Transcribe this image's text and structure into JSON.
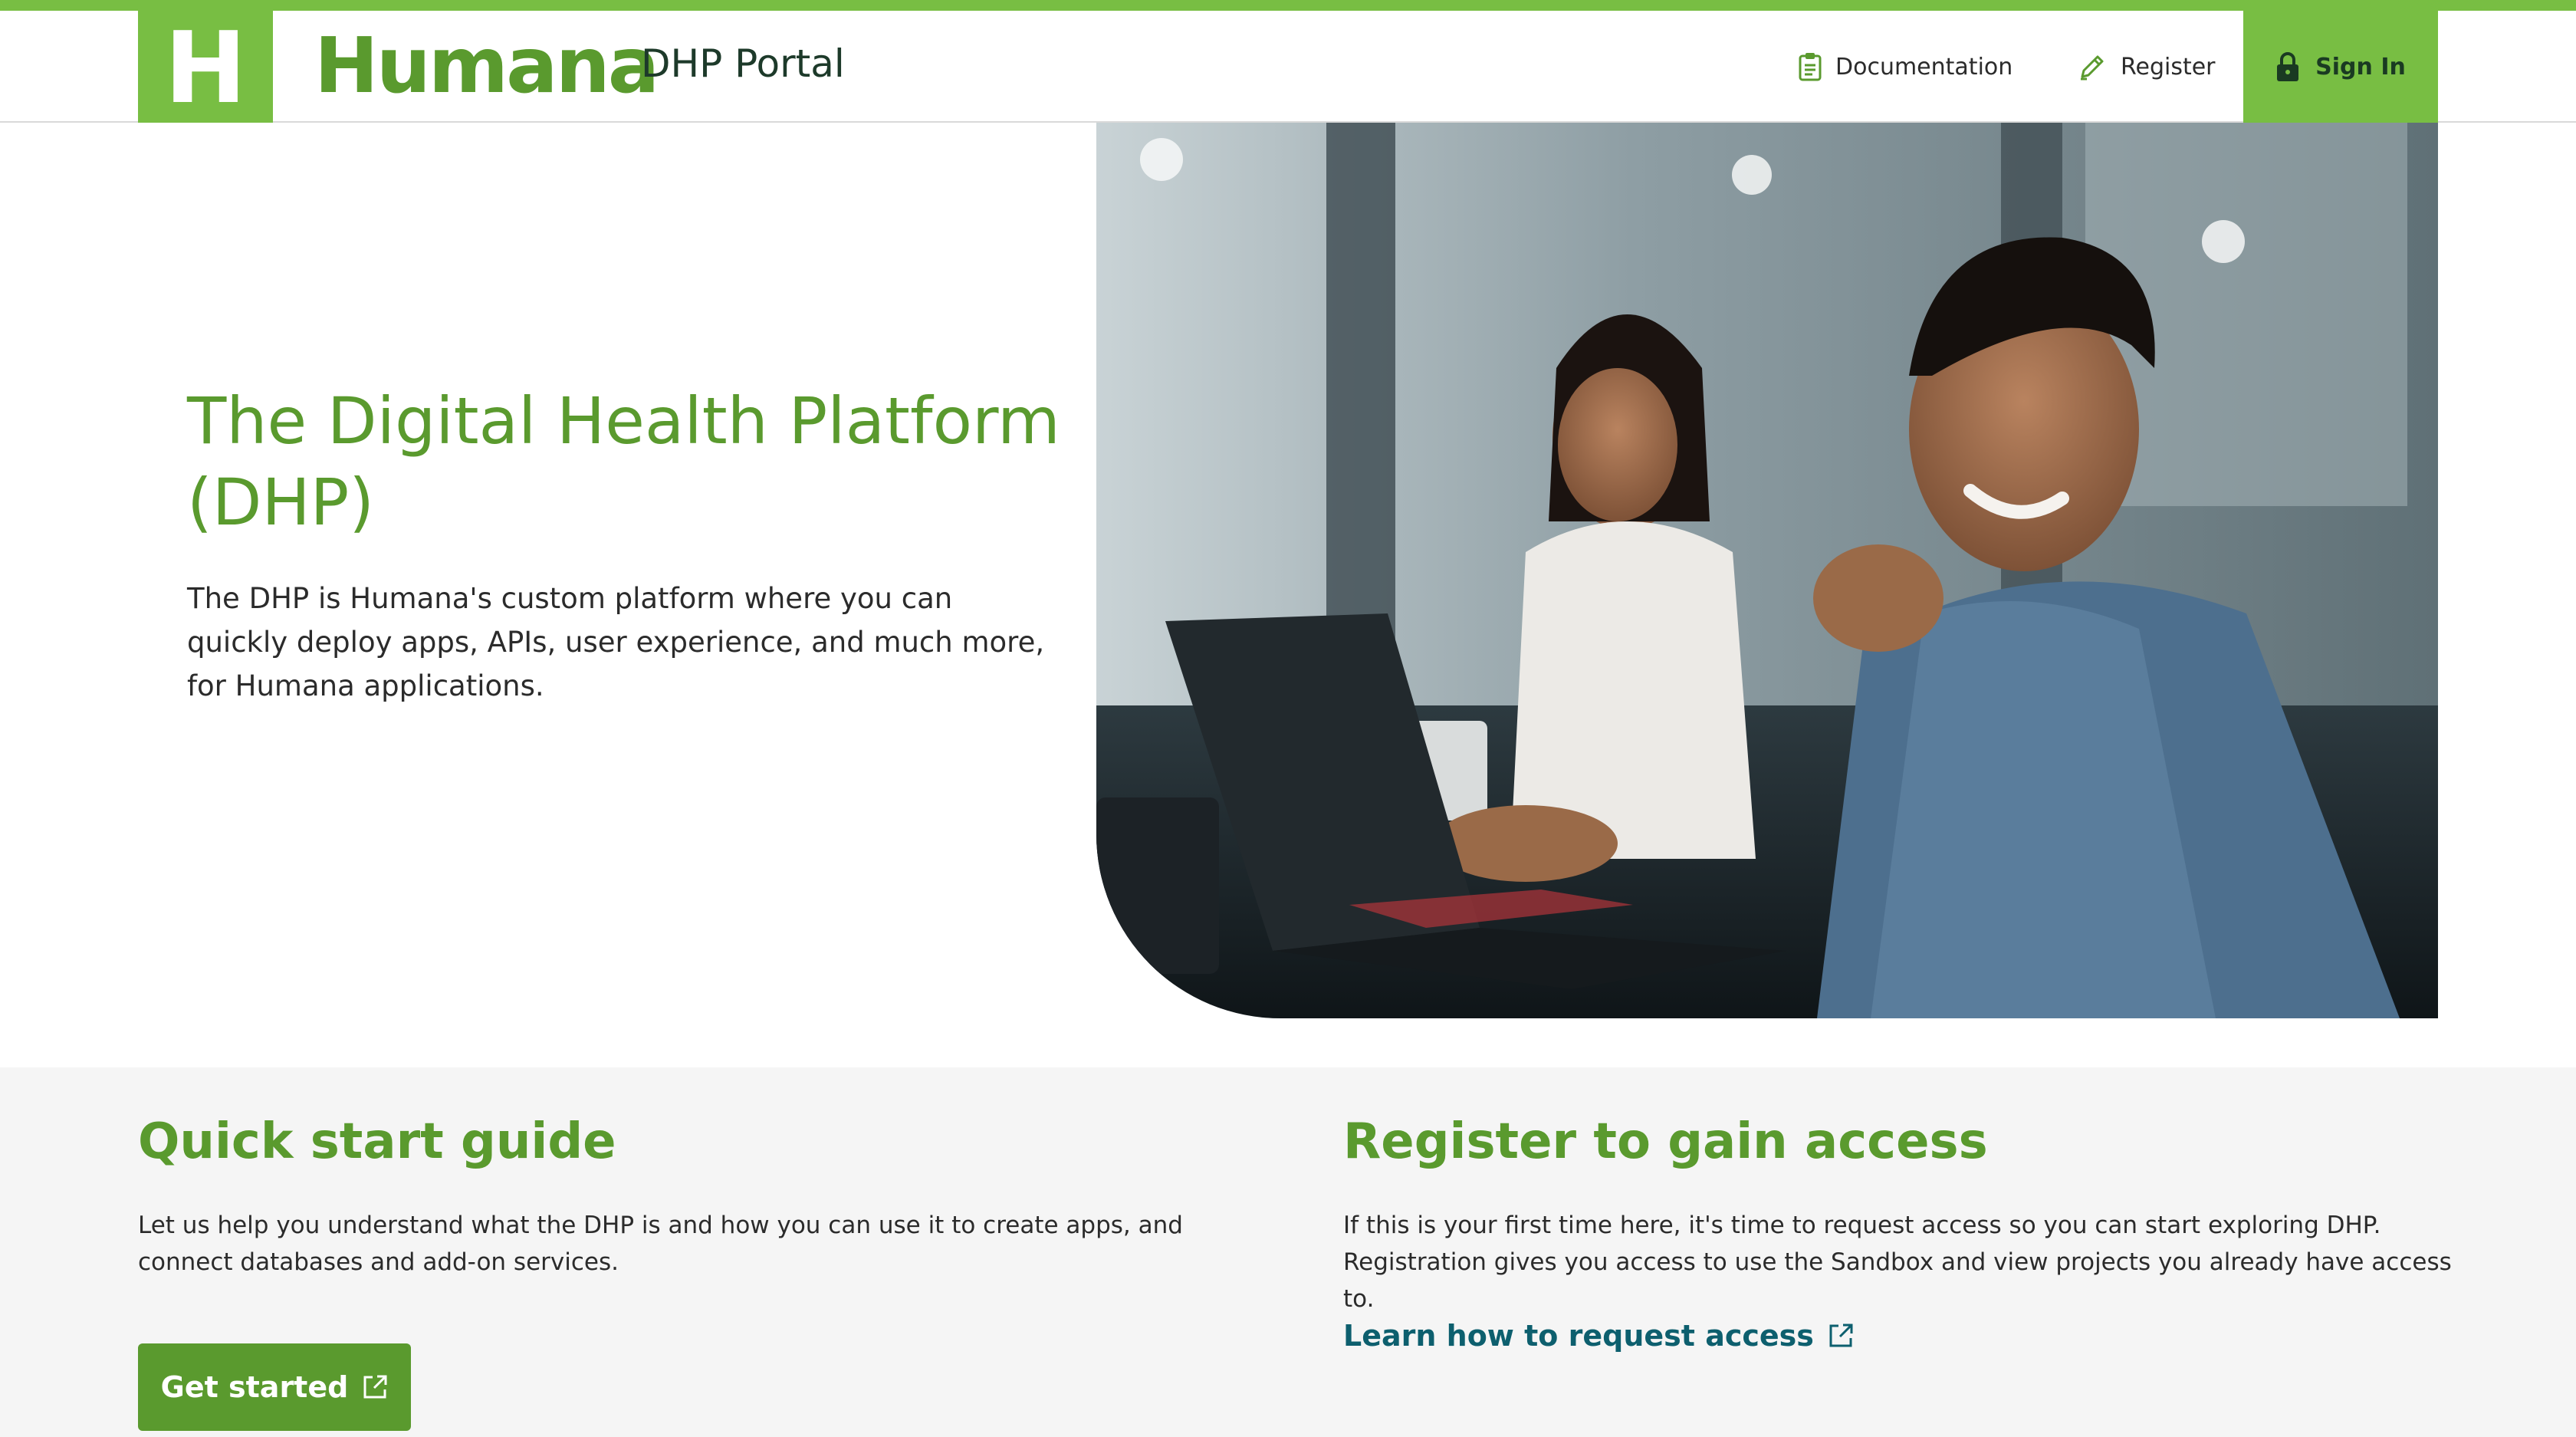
{
  "header": {
    "logo_letter": "H",
    "brand_name": "Humana",
    "portal_name": "DHP Portal",
    "nav": [
      {
        "label": "Documentation",
        "icon": "clipboard-icon"
      },
      {
        "label": "Register",
        "icon": "pencil-icon"
      }
    ],
    "sign_in": {
      "label": "Sign In",
      "icon": "lock-icon"
    }
  },
  "hero": {
    "title": "The Digital Health Platform (DHP)",
    "description": "The DHP is Humana's custom platform where you can quickly deploy apps, APIs, user experience, and much more, for Humana applications."
  },
  "sections": {
    "quick_start": {
      "title": "Quick start guide",
      "text": "Let us help you understand what the DHP is and how you can use it to create apps, and connect databases and add-on services.",
      "button_label": "Get started"
    },
    "register": {
      "title": "Register to gain access",
      "text": "If this is your first time here, it's time to request access so you can start exploring DHP. Registration gives you access to use the Sandbox and view projects you already have access to.",
      "link_label": "Learn how to request access"
    }
  },
  "colors": {
    "brand_green": "#78be43",
    "heading_green": "#5a9a2e",
    "link_teal": "#0d5f6e"
  }
}
